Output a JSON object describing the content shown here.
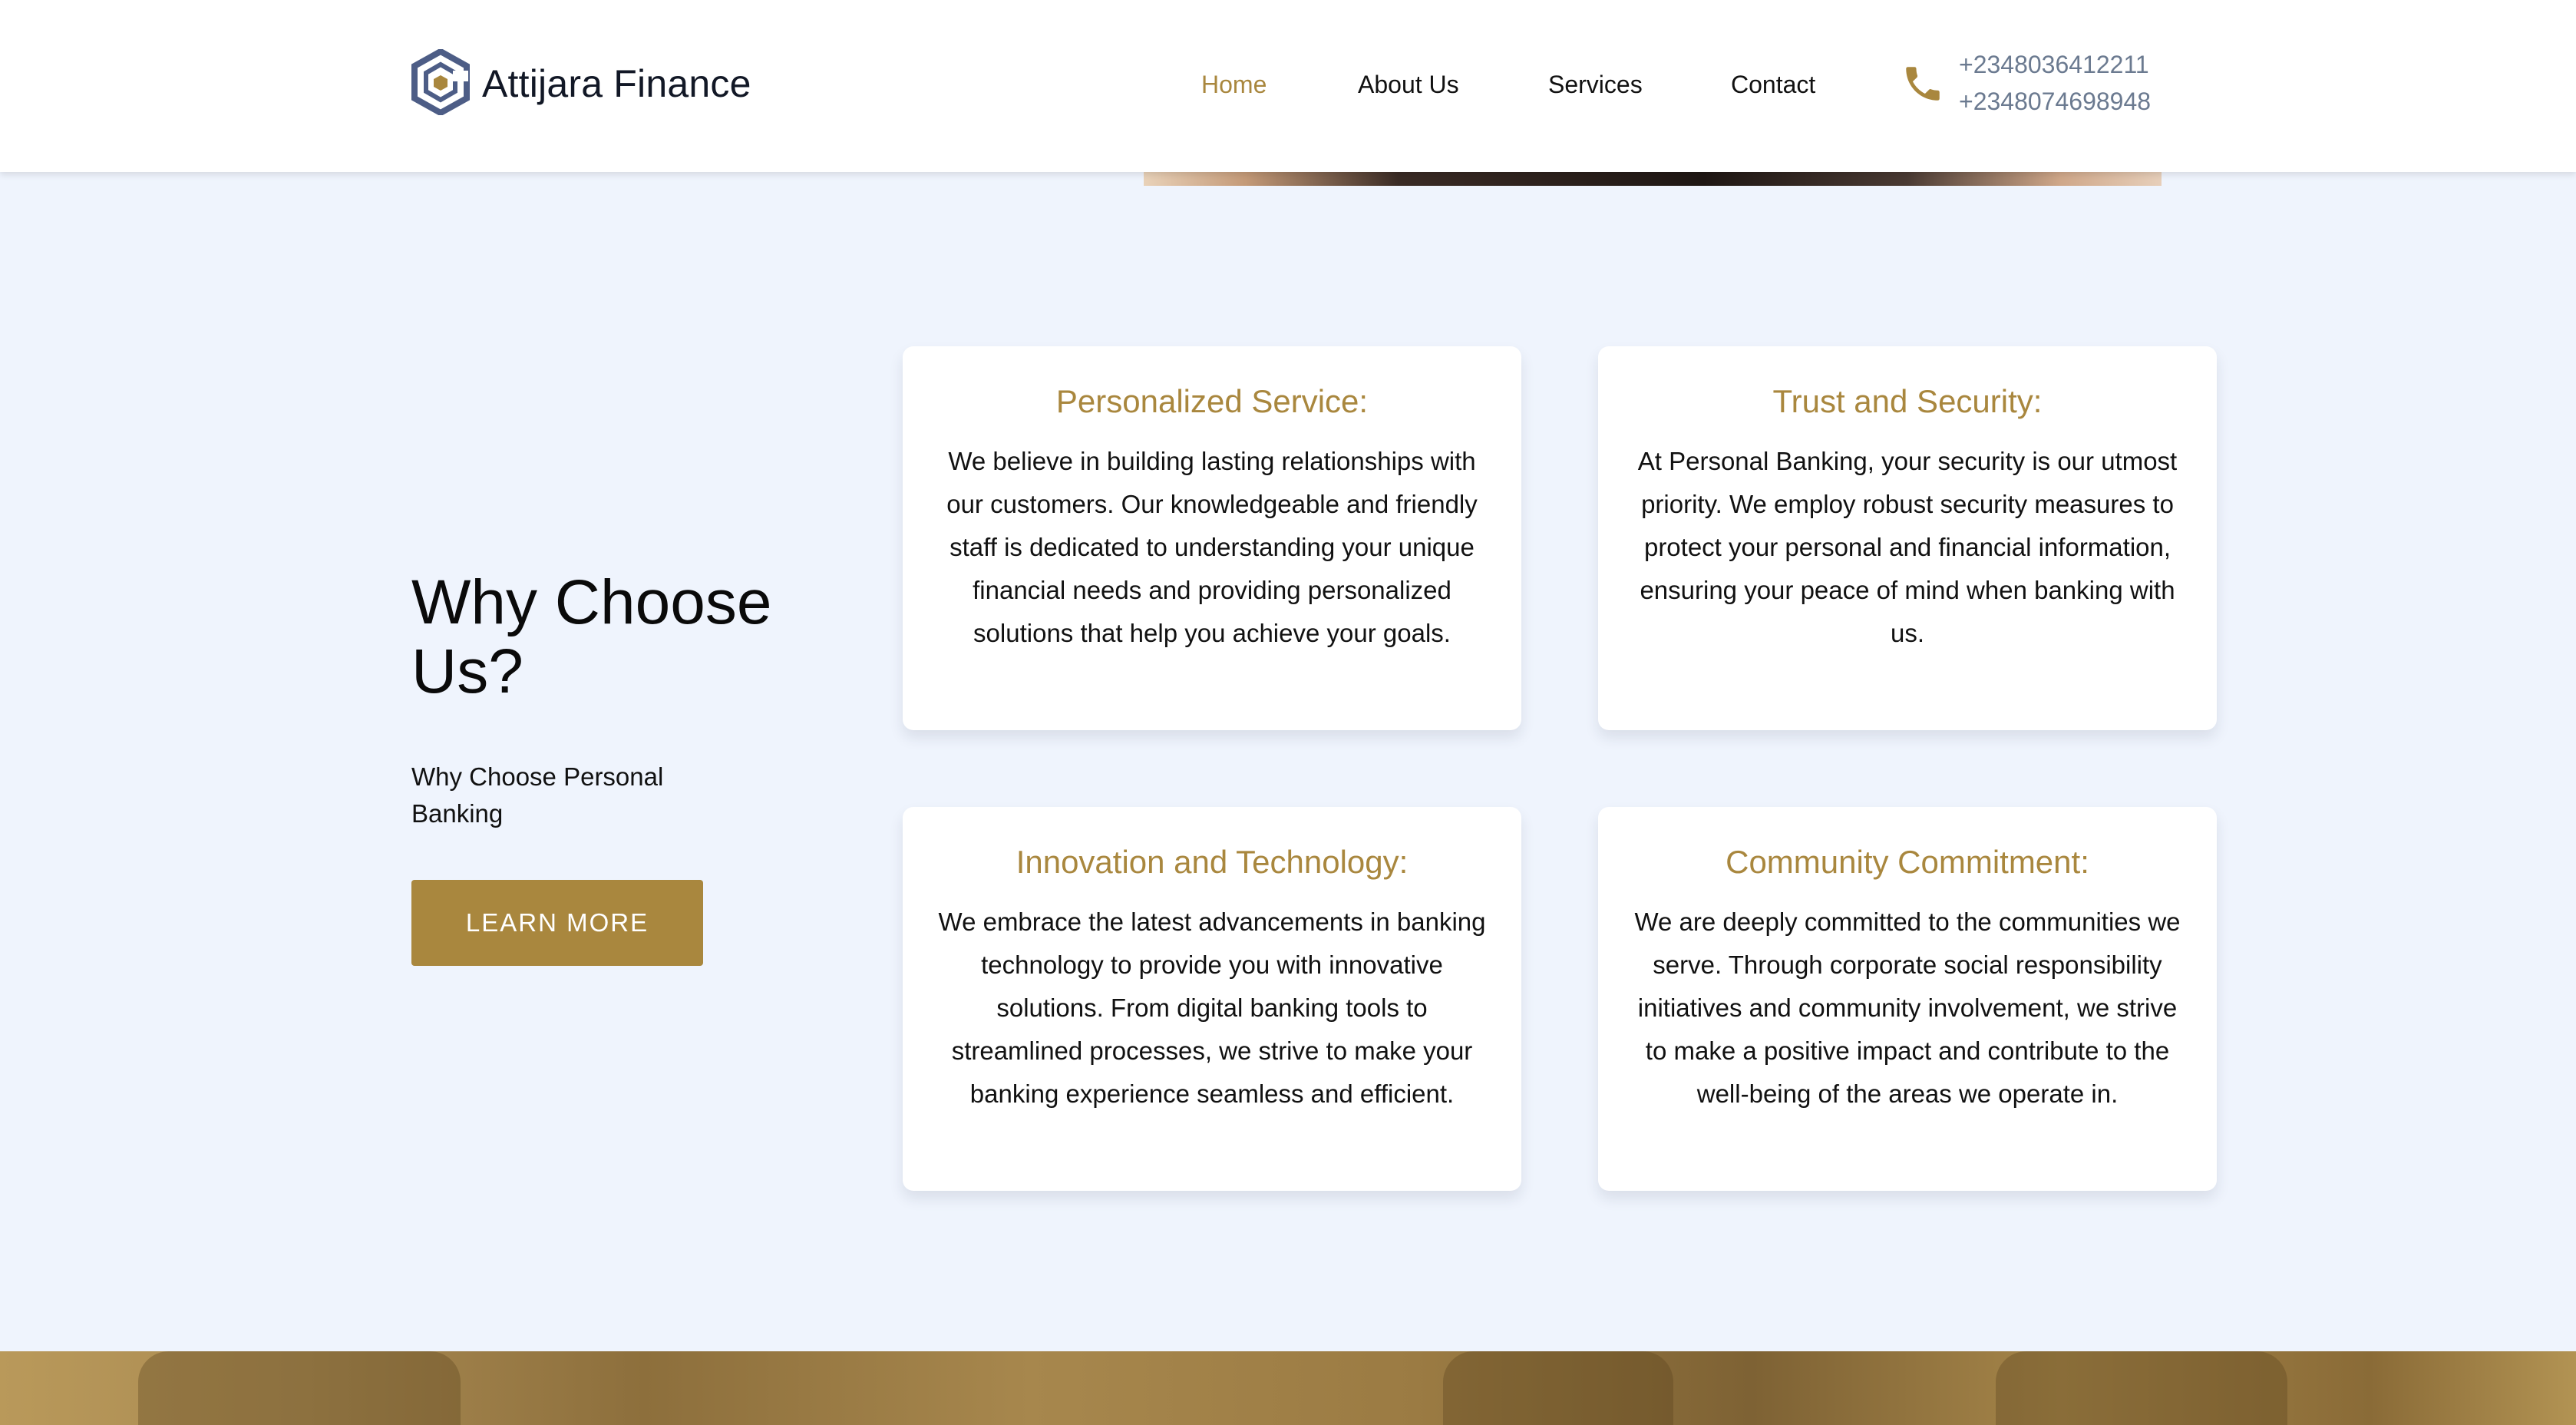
{
  "header": {
    "brand": "Attijara Finance",
    "nav": [
      "Home",
      "About Us",
      "Services",
      "Contact"
    ],
    "active_nav": "Home",
    "phones": [
      "+2348036412211",
      "+2348074698948"
    ]
  },
  "why": {
    "title": "Why Choose Us?",
    "subtitle": "Why Choose Personal Banking",
    "button": "LEARN MORE"
  },
  "cards": [
    {
      "title": "Personalized Service:",
      "body": "We believe in building lasting relationships with our customers. Our knowledgeable and friendly staff is dedicated to understanding your unique financial needs and providing personalized solutions that help you achieve your goals."
    },
    {
      "title": "Trust and Security:",
      "body": "At Personal Banking, your security is our utmost priority. We employ robust security measures to protect your personal and financial information, ensuring your peace of mind when banking with us."
    },
    {
      "title": "Innovation and Technology:",
      "body": "We embrace the latest advancements in banking technology to provide you with innovative solutions. From digital banking tools to streamlined processes, we strive to make your banking experience seamless and efficient."
    },
    {
      "title": "Community Commitment:",
      "body": "We are deeply committed to the communities we serve. Through corporate social responsibility initiatives and community involvement, we strive to make a positive impact and contribute to the well-being of the areas we operate in."
    }
  ],
  "colors": {
    "accent": "#a9873e",
    "background": "#eff4fd",
    "phone_text": "#6b7a90",
    "logo_blue": "#4d5d86"
  },
  "icons": {
    "logo": "hexagon-logo-icon",
    "phone": "phone-icon"
  }
}
